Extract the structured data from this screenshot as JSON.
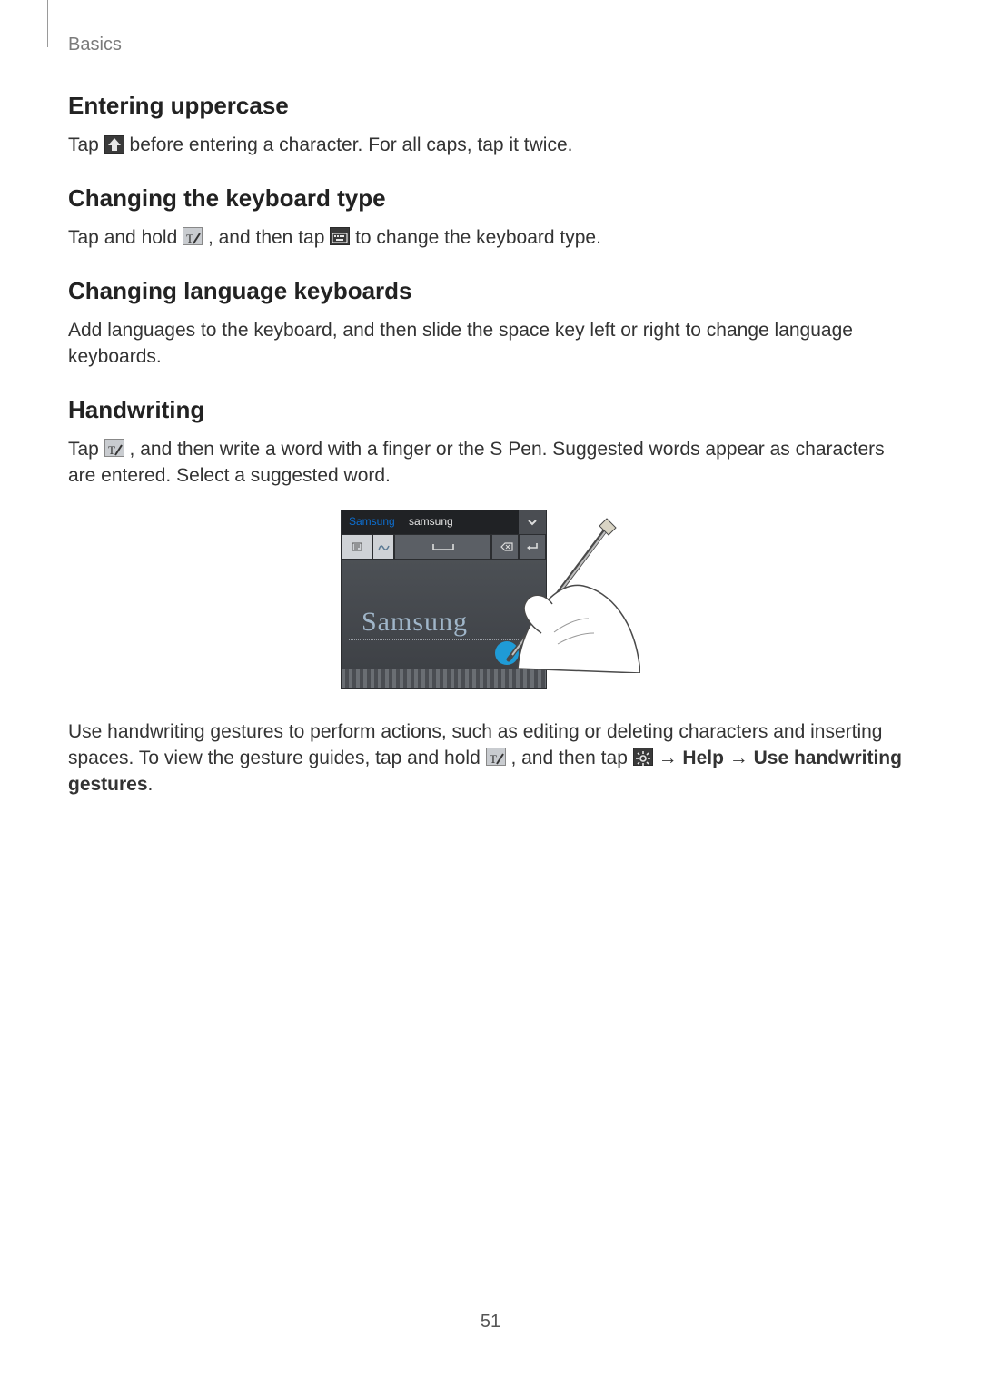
{
  "header": {
    "section_label": "Basics"
  },
  "sections": {
    "s1": {
      "heading": "Entering uppercase",
      "p1a": "Tap ",
      "p1b": " before entering a character. For all caps, tap it twice."
    },
    "s2": {
      "heading": "Changing the keyboard type",
      "p1a": "Tap and hold ",
      "p1b": ", and then tap ",
      "p1c": " to change the keyboard type."
    },
    "s3": {
      "heading": "Changing language keyboards",
      "p1": "Add languages to the keyboard, and then slide the space key left or right to change language keyboards."
    },
    "s4": {
      "heading": "Handwriting",
      "p1a": "Tap ",
      "p1b": ", and then write a word with a finger or the S Pen. Suggested words appear as characters are entered. Select a suggested word.",
      "p2a": "Use handwriting gestures to perform actions, such as editing or deleting characters and inserting spaces. To view the gesture guides, tap and hold ",
      "p2b": ", and then tap ",
      "p2c": " → ",
      "p2d_bold": "Help",
      "p2e": " → ",
      "p2f_bold": "Use handwriting gestures",
      "p2g": "."
    }
  },
  "illustration": {
    "suggestion1": "Samsung",
    "suggestion2": "samsung",
    "handwritten": "Samsung"
  },
  "page_number": "51"
}
